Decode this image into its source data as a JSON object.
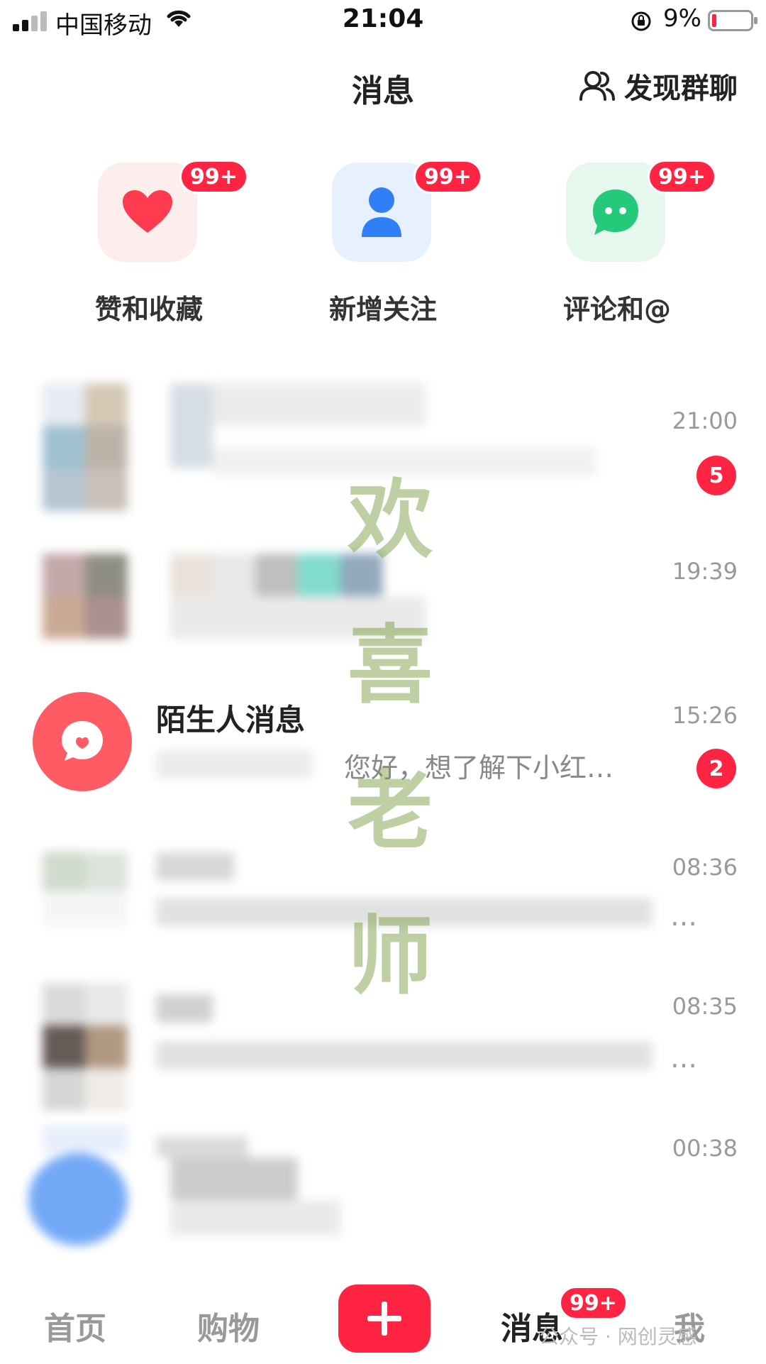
{
  "status_bar": {
    "carrier": "中国移动",
    "time": "21:04",
    "battery_percent": "9%"
  },
  "header": {
    "title": "消息",
    "discover_label": "发现群聊"
  },
  "quick_entries": [
    {
      "label": "赞和收藏",
      "badge": "99+",
      "icon": "heart-icon",
      "color": "#ff3b4f"
    },
    {
      "label": "新增关注",
      "badge": "99+",
      "icon": "person-icon",
      "color": "#2f7ff7"
    },
    {
      "label": "评论和@",
      "badge": "99+",
      "icon": "chat-bubble-icon",
      "color": "#25c97a"
    }
  ],
  "conversations": [
    {
      "time": "21:00",
      "unread": "5"
    },
    {
      "time": "19:39"
    },
    {
      "name": "陌生人消息",
      "preview": "您好，想了解下小红…",
      "time": "15:26",
      "unread": "2"
    },
    {
      "time": "08:36",
      "preview_tail": "…"
    },
    {
      "time": "08:35",
      "preview_tail": "…"
    },
    {
      "time": "00:38"
    }
  ],
  "watermark": [
    "欢",
    "喜",
    "老",
    "师"
  ],
  "tab_bar": {
    "home": "首页",
    "shop": "购物",
    "messages": "消息",
    "messages_badge": "99+",
    "me": "我"
  },
  "corner_watermark": "公众号 · 网创灵感",
  "colors": {
    "accent": "#ff2442"
  }
}
